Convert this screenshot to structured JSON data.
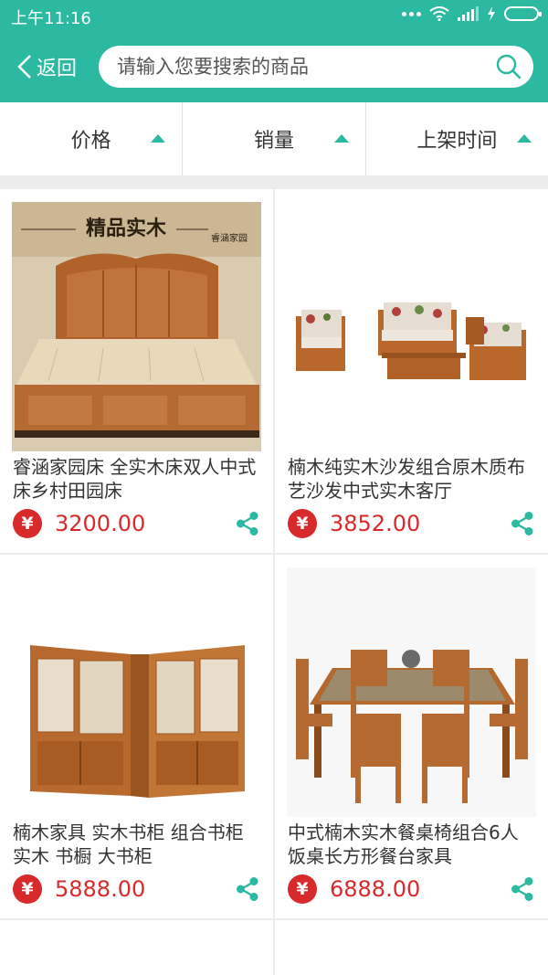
{
  "status_bar": {
    "time": "上午11:16"
  },
  "header": {
    "back_label": "返回",
    "search_placeholder": "请输入您要搜索的商品"
  },
  "sort_tabs": [
    {
      "label": "价格"
    },
    {
      "label": "销量"
    },
    {
      "label": "上架时间"
    }
  ],
  "products": [
    {
      "title": "睿涵家园床 全实木床双人中式床乡村田园床",
      "price": "3200.00",
      "image_banner": "精品实木",
      "image_brand": "睿涵家园"
    },
    {
      "title": "楠木纯实木沙发组合原木质布艺沙发中式实木客厅",
      "price": "3852.00"
    },
    {
      "title": "楠木家具 实木书柜 组合书柜 实木 书橱 大书柜",
      "price": "5888.00"
    },
    {
      "title": "中式楠木实木餐桌椅组合6人饭桌长方形餐台家具",
      "price": "6888.00"
    }
  ],
  "currency_symbol": "¥",
  "colors": {
    "accent": "#2bb9a1",
    "price": "#d8292b"
  }
}
